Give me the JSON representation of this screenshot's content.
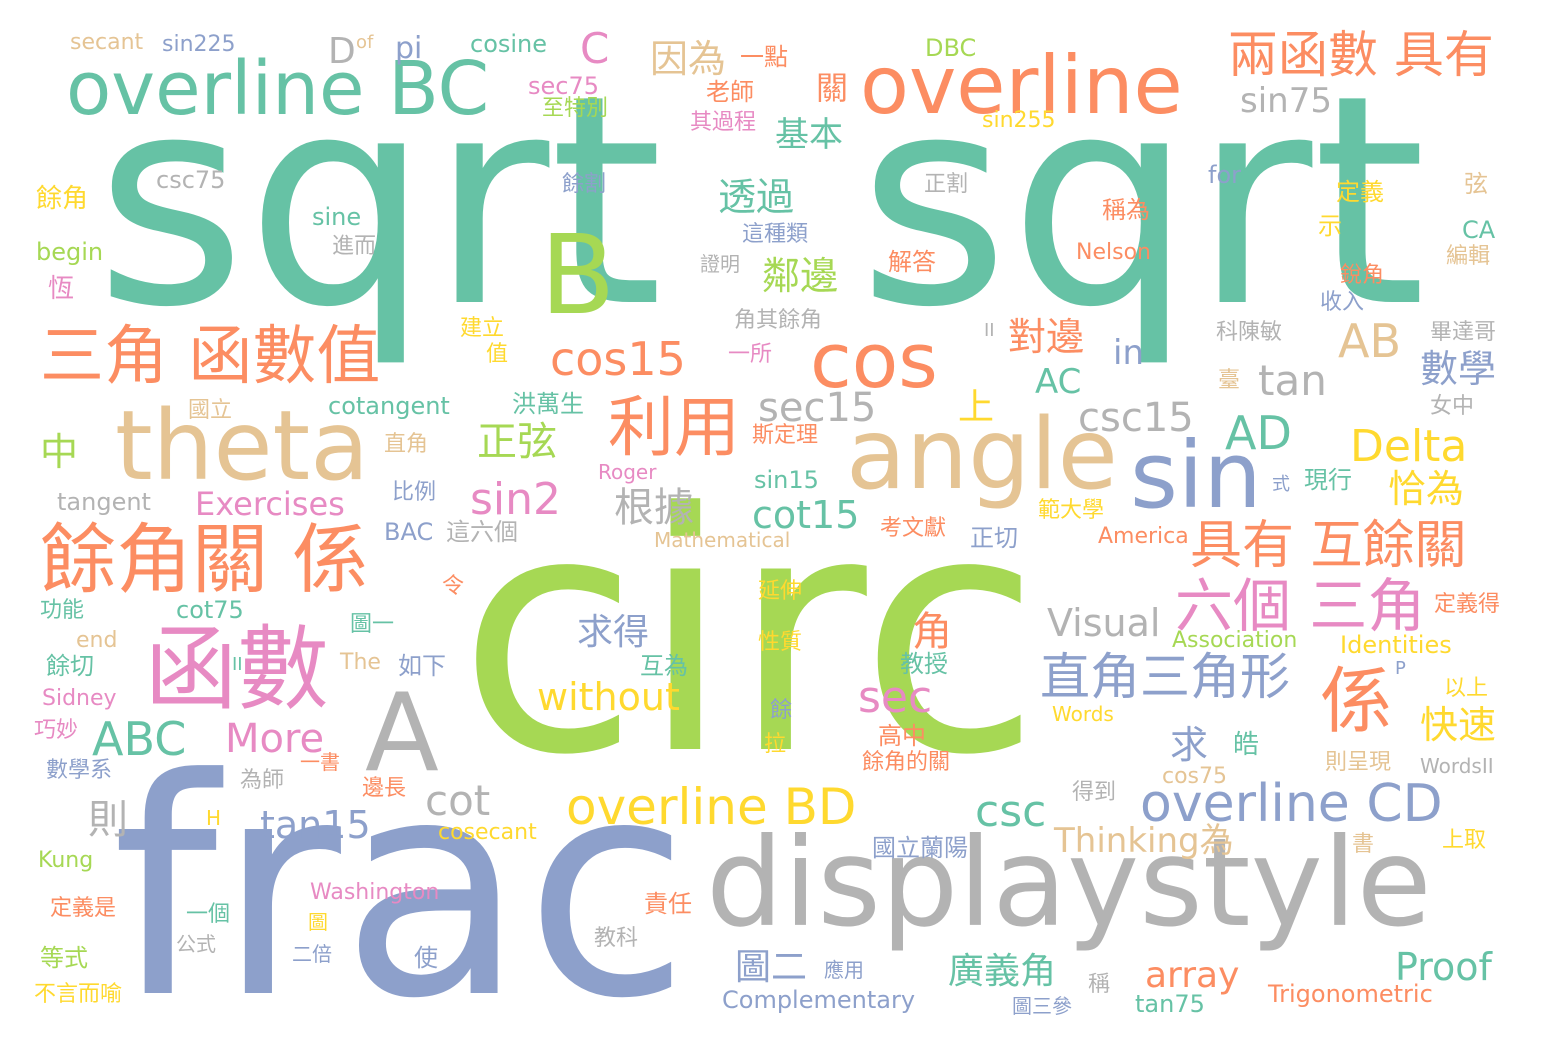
{
  "palette": {
    "green": "#66c2a5",
    "orange": "#fc8d62",
    "blue": "#8da0cb",
    "pink": "#e78ac3",
    "lime": "#a6d854",
    "yellow": "#ffd92f",
    "tan": "#e5c494",
    "gray": "#b3b3b3"
  },
  "words": [
    {
      "text": "sqrt",
      "color": "green"
    },
    {
      "text": "sqrt",
      "color": "green"
    },
    {
      "text": "circ",
      "color": "lime"
    },
    {
      "text": "frac",
      "color": "blue"
    },
    {
      "text": "displaystyle",
      "color": "gray"
    },
    {
      "text": "overline",
      "color": "orange"
    },
    {
      "text": "overline BC",
      "color": "green"
    },
    {
      "text": "theta",
      "color": "tan"
    },
    {
      "text": "angle",
      "color": "tan"
    },
    {
      "text": "B",
      "color": "lime"
    },
    {
      "text": "A",
      "color": "gray"
    },
    {
      "text": "sin",
      "color": "blue"
    },
    {
      "text": "cos",
      "color": "orange"
    },
    {
      "text": "函數",
      "color": "pink"
    },
    {
      "text": "三角 函數值",
      "color": "orange"
    },
    {
      "text": "餘角關 係",
      "color": "orange"
    },
    {
      "text": "兩函數 具有",
      "color": "orange"
    },
    {
      "text": "利用",
      "color": "orange"
    },
    {
      "text": "係",
      "color": "orange"
    },
    {
      "text": "overline BD",
      "color": "yellow"
    },
    {
      "text": "overline CD",
      "color": "blue"
    },
    {
      "text": "具有 互餘關",
      "color": "orange"
    },
    {
      "text": "六個 三角",
      "color": "pink"
    },
    {
      "text": "直角三角形",
      "color": "blue"
    },
    {
      "text": "cos15",
      "color": "orange"
    },
    {
      "text": "AB",
      "color": "tan"
    },
    {
      "text": "AD",
      "color": "green"
    },
    {
      "text": "Delta",
      "color": "yellow"
    },
    {
      "text": "sin2",
      "color": "pink"
    },
    {
      "text": "cot",
      "color": "gray"
    },
    {
      "text": "csc",
      "color": "green"
    },
    {
      "text": "sec",
      "color": "pink"
    },
    {
      "text": "tan",
      "color": "gray"
    },
    {
      "text": "csc15",
      "color": "gray"
    },
    {
      "text": "sec15",
      "color": "gray"
    },
    {
      "text": "cot15",
      "color": "green"
    },
    {
      "text": "tan15",
      "color": "blue"
    },
    {
      "text": "ABC",
      "color": "green"
    },
    {
      "text": "More",
      "color": "pink"
    },
    {
      "text": "without",
      "color": "yellow"
    },
    {
      "text": "Visual",
      "color": "gray"
    },
    {
      "text": "Proof",
      "color": "green"
    },
    {
      "text": "array",
      "color": "orange"
    },
    {
      "text": "Thinking為",
      "color": "tan"
    },
    {
      "text": "Exercises",
      "color": "pink"
    },
    {
      "text": "sin75",
      "color": "gray"
    },
    {
      "text": "AC",
      "color": "green"
    },
    {
      "text": "in",
      "color": "blue"
    },
    {
      "text": "C",
      "color": "pink"
    },
    {
      "text": "D",
      "color": "gray"
    },
    {
      "text": "pi",
      "color": "blue"
    },
    {
      "text": "因為",
      "color": "tan"
    },
    {
      "text": "一點",
      "color": "orange"
    },
    {
      "text": "老師",
      "color": "orange"
    },
    {
      "text": "關",
      "color": "orange"
    },
    {
      "text": "基本",
      "color": "green"
    },
    {
      "text": "透過",
      "color": "green"
    },
    {
      "text": "鄰邊",
      "color": "lime"
    },
    {
      "text": "對邊",
      "color": "orange"
    },
    {
      "text": "數學",
      "color": "blue"
    },
    {
      "text": "恰為",
      "color": "yellow"
    },
    {
      "text": "正弦",
      "color": "lime"
    },
    {
      "text": "根據",
      "color": "gray"
    },
    {
      "text": "上",
      "color": "yellow"
    },
    {
      "text": "中",
      "color": "lime"
    },
    {
      "text": "求得",
      "color": "blue"
    },
    {
      "text": "角",
      "color": "orange"
    },
    {
      "text": "快速",
      "color": "yellow"
    },
    {
      "text": "求",
      "color": "blue"
    },
    {
      "text": "則",
      "color": "gray"
    },
    {
      "text": "圖二",
      "color": "blue"
    },
    {
      "text": "廣義角",
      "color": "green"
    },
    {
      "text": "皓",
      "color": "green"
    },
    {
      "text": "secant",
      "color": "tan"
    },
    {
      "text": "sin225",
      "color": "blue"
    },
    {
      "text": "of",
      "color": "tan"
    },
    {
      "text": "cosine",
      "color": "green"
    },
    {
      "text": "sec75",
      "color": "pink"
    },
    {
      "text": "至特別",
      "color": "lime"
    },
    {
      "text": "其過程",
      "color": "pink"
    },
    {
      "text": "DBC",
      "color": "lime"
    },
    {
      "text": "sin255",
      "color": "yellow"
    },
    {
      "text": "csc75",
      "color": "gray"
    },
    {
      "text": "餘角",
      "color": "yellow"
    },
    {
      "text": "begin",
      "color": "lime"
    },
    {
      "text": "恆",
      "color": "pink"
    },
    {
      "text": "sine",
      "color": "green"
    },
    {
      "text": "進而",
      "color": "gray"
    },
    {
      "text": "餘割",
      "color": "blue"
    },
    {
      "text": "正割",
      "color": "gray"
    },
    {
      "text": "for",
      "color": "blue"
    },
    {
      "text": "稱為",
      "color": "orange"
    },
    {
      "text": "定義",
      "color": "yellow"
    },
    {
      "text": "弦",
      "color": "tan"
    },
    {
      "text": "CA",
      "color": "green"
    },
    {
      "text": "示",
      "color": "yellow"
    },
    {
      "text": "編輯",
      "color": "tan"
    },
    {
      "text": "這種類",
      "color": "blue"
    },
    {
      "text": "證明",
      "color": "gray"
    },
    {
      "text": "解答",
      "color": "orange"
    },
    {
      "text": "Nelson",
      "color": "orange"
    },
    {
      "text": "銳角",
      "color": "orange"
    },
    {
      "text": "收入",
      "color": "blue"
    },
    {
      "text": "建立",
      "color": "yellow"
    },
    {
      "text": "值",
      "color": "yellow"
    },
    {
      "text": "角其餘角",
      "color": "gray"
    },
    {
      "text": "一所",
      "color": "pink"
    },
    {
      "text": "II",
      "color": "gray"
    },
    {
      "text": "科陳敏",
      "color": "gray"
    },
    {
      "text": "畢達哥",
      "color": "gray"
    },
    {
      "text": "臺",
      "color": "tan"
    },
    {
      "text": "女中",
      "color": "gray"
    },
    {
      "text": "國立",
      "color": "tan"
    },
    {
      "text": "cotangent",
      "color": "green"
    },
    {
      "text": "洪萬生",
      "color": "green"
    },
    {
      "text": "直角",
      "color": "tan"
    },
    {
      "text": "斯定理",
      "color": "orange"
    },
    {
      "text": "Roger",
      "color": "pink"
    },
    {
      "text": "sin15",
      "color": "green"
    },
    {
      "text": "式",
      "color": "blue"
    },
    {
      "text": "現行",
      "color": "green"
    },
    {
      "text": "範大學",
      "color": "yellow"
    },
    {
      "text": "tangent",
      "color": "gray"
    },
    {
      "text": "比例",
      "color": "blue"
    },
    {
      "text": "BAC",
      "color": "blue"
    },
    {
      "text": "這六個",
      "color": "gray"
    },
    {
      "text": "Mathematical",
      "color": "tan"
    },
    {
      "text": "考文獻",
      "color": "orange"
    },
    {
      "text": "正切",
      "color": "blue"
    },
    {
      "text": "America",
      "color": "orange"
    },
    {
      "text": "令",
      "color": "orange"
    },
    {
      "text": "延伸",
      "color": "yellow"
    },
    {
      "text": "功能",
      "color": "green"
    },
    {
      "text": "cot75",
      "color": "green"
    },
    {
      "text": "定義得",
      "color": "orange"
    },
    {
      "text": "end",
      "color": "tan"
    },
    {
      "text": "圖一",
      "color": "green"
    },
    {
      "text": "Association",
      "color": "lime"
    },
    {
      "text": "Identities",
      "color": "yellow"
    },
    {
      "text": "餘切",
      "color": "green"
    },
    {
      "text": "II",
      "color": "green"
    },
    {
      "text": "The",
      "color": "tan"
    },
    {
      "text": "如下",
      "color": "blue"
    },
    {
      "text": "互為",
      "color": "green"
    },
    {
      "text": "性質",
      "color": "yellow"
    },
    {
      "text": "教授",
      "color": "green"
    },
    {
      "text": "P",
      "color": "blue"
    },
    {
      "text": "Sidney",
      "color": "pink"
    },
    {
      "text": "以上",
      "color": "yellow"
    },
    {
      "text": "巧妙",
      "color": "pink"
    },
    {
      "text": "餘",
      "color": "blue"
    },
    {
      "text": "Words",
      "color": "yellow"
    },
    {
      "text": "高中",
      "color": "orange"
    },
    {
      "text": "拉",
      "color": "yellow"
    },
    {
      "text": "餘角的關",
      "color": "orange"
    },
    {
      "text": "數學系",
      "color": "blue"
    },
    {
      "text": "一書",
      "color": "orange"
    },
    {
      "text": "為師",
      "color": "gray"
    },
    {
      "text": "則呈現",
      "color": "tan"
    },
    {
      "text": "WordsII",
      "color": "gray"
    },
    {
      "text": "邊長",
      "color": "orange"
    },
    {
      "text": "cos75",
      "color": "tan"
    },
    {
      "text": "得到",
      "color": "gray"
    },
    {
      "text": "H",
      "color": "yellow"
    },
    {
      "text": "cosecant",
      "color": "yellow"
    },
    {
      "text": "國立蘭陽",
      "color": "blue"
    },
    {
      "text": "書",
      "color": "tan"
    },
    {
      "text": "上取",
      "color": "yellow"
    },
    {
      "text": "Kung",
      "color": "lime"
    },
    {
      "text": "Washington",
      "color": "pink"
    },
    {
      "text": "定義是",
      "color": "orange"
    },
    {
      "text": "一個",
      "color": "green"
    },
    {
      "text": "圖",
      "color": "yellow"
    },
    {
      "text": "責任",
      "color": "orange"
    },
    {
      "text": "教科",
      "color": "gray"
    },
    {
      "text": "公式",
      "color": "gray"
    },
    {
      "text": "二倍",
      "color": "blue"
    },
    {
      "text": "等式",
      "color": "lime"
    },
    {
      "text": "使",
      "color": "blue"
    },
    {
      "text": "應用",
      "color": "blue"
    },
    {
      "text": "稱",
      "color": "gray"
    },
    {
      "text": "不言而喻",
      "color": "yellow"
    },
    {
      "text": "Complementary",
      "color": "blue"
    },
    {
      "text": "圖三參",
      "color": "blue"
    },
    {
      "text": "tan75",
      "color": "green"
    },
    {
      "text": "Trigonometric",
      "color": "orange"
    }
  ]
}
